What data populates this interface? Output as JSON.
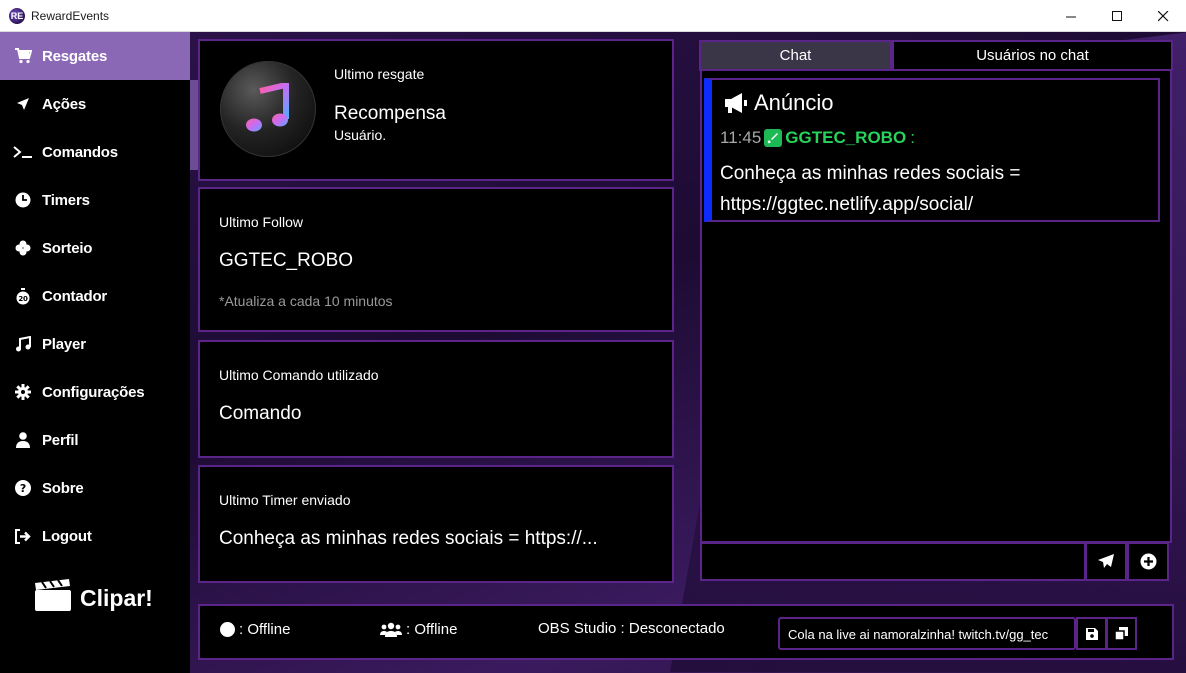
{
  "window": {
    "title": "RewardEvents",
    "app_icon_glyph": "RE"
  },
  "sidebar": {
    "items": [
      {
        "label": "Resgates",
        "icon": "cart-icon",
        "active": true
      },
      {
        "label": "Ações",
        "icon": "arrow-icon"
      },
      {
        "label": "Comandos",
        "icon": "terminal-icon"
      },
      {
        "label": "Timers",
        "icon": "clock-icon"
      },
      {
        "label": "Sorteio",
        "icon": "clover-icon"
      },
      {
        "label": "Contador",
        "icon": "stopwatch-icon"
      },
      {
        "label": "Player",
        "icon": "music-note-icon"
      },
      {
        "label": "Configurações",
        "icon": "gear-icon"
      },
      {
        "label": "Perfil",
        "icon": "user-icon"
      },
      {
        "label": "Sobre",
        "icon": "question-icon"
      },
      {
        "label": "Logout",
        "icon": "logout-icon"
      }
    ],
    "clip_label": "Clipar!"
  },
  "cards": {
    "redeem": {
      "label": "Ultimo resgate",
      "value": "Recompensa",
      "sub": "Usuário."
    },
    "follow": {
      "label": "Ultimo Follow",
      "value": "GGTEC_ROBO",
      "note": "*Atualiza a cada 10 minutos"
    },
    "command": {
      "label": "Ultimo Comando utilizado",
      "value": "Comando"
    },
    "timer": {
      "label": "Ultimo Timer enviado",
      "value": "Conheça as minhas redes sociais = https://..."
    }
  },
  "chat": {
    "tabs": [
      "Chat",
      "Usuários no chat"
    ],
    "message": {
      "header": "Anúncio",
      "time": "11:45",
      "user": "GGTEC_ROBO",
      "colon": ":",
      "text": "Conheça as minhas redes sociais = https://ggtec.netlify.app/social/"
    },
    "input_value": ""
  },
  "status": {
    "twitch": ": Offline",
    "users": ": Offline",
    "obs": "OBS Studio : Desconectado",
    "title_value": "Cola na live ai namoralzinha!  twitch.tv/gg_tec"
  },
  "colors": {
    "accent_border": "#5a2489",
    "sidebar_active": "#8b68b6",
    "announcement_bar": "#0d2bff",
    "username_green": "#27d35a"
  }
}
